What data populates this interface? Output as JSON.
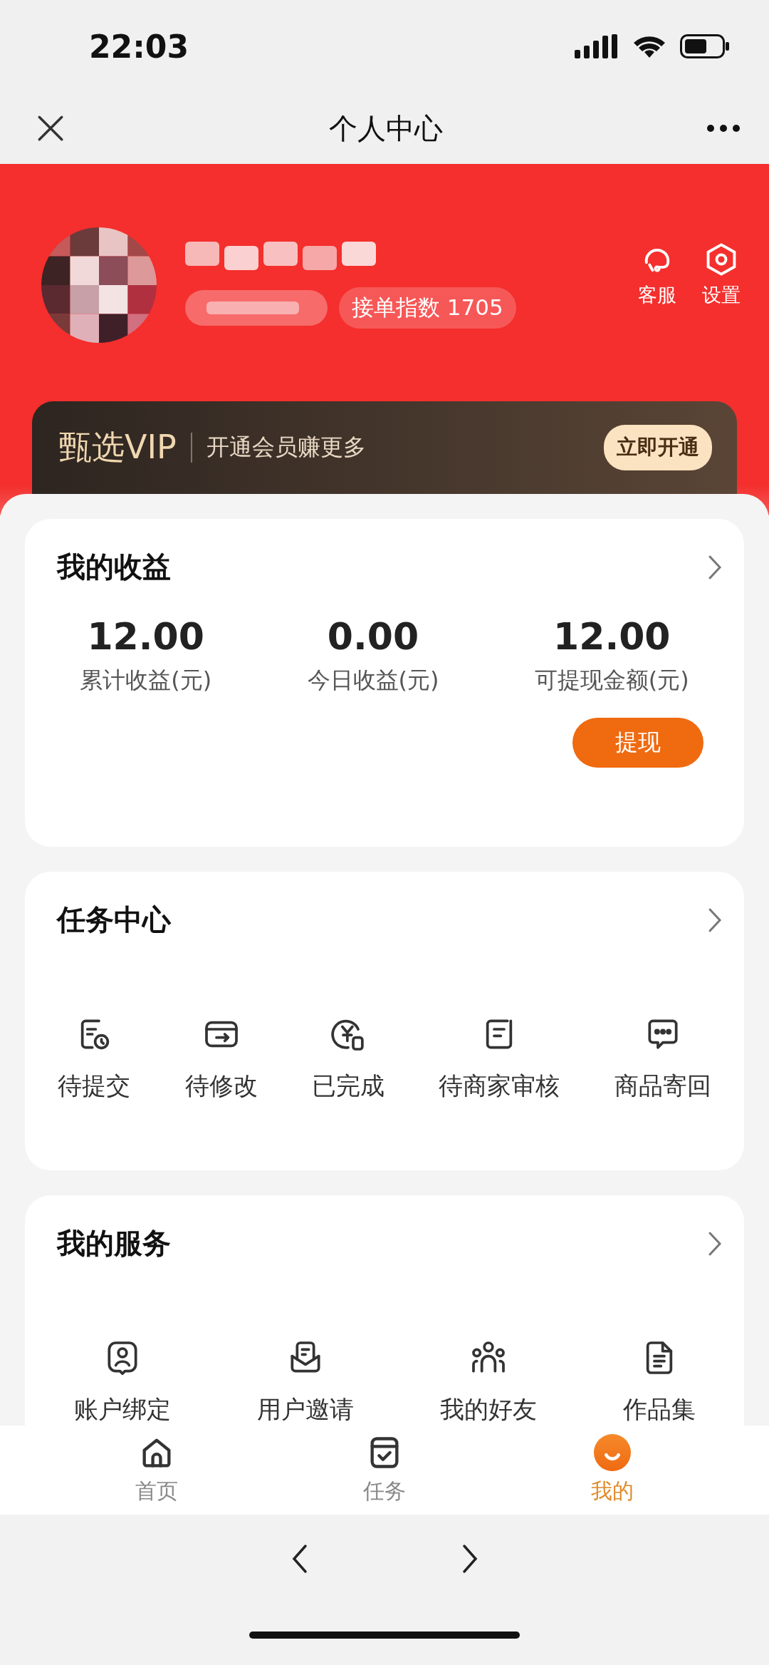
{
  "status_bar": {
    "time": "22:03"
  },
  "nav": {
    "title": "个人中心"
  },
  "profile": {
    "score_badge": "接单指数 1705",
    "actions": [
      {
        "label": "客服"
      },
      {
        "label": "设置"
      }
    ]
  },
  "vip": {
    "brand": "甄选VIP",
    "slogan": "开通会员赚更多",
    "button": "立即开通"
  },
  "income": {
    "title": "我的收益",
    "stats": [
      {
        "value": "12.00",
        "label": "累计收益(元)"
      },
      {
        "value": "0.00",
        "label": "今日收益(元)"
      },
      {
        "value": "12.00",
        "label": "可提现金额(元)"
      }
    ],
    "button": "提现"
  },
  "tasks": {
    "title": "任务中心",
    "items": [
      {
        "label": "待提交"
      },
      {
        "label": "待修改"
      },
      {
        "label": "已完成"
      },
      {
        "label": "待商家审核"
      },
      {
        "label": "商品寄回"
      }
    ]
  },
  "services": {
    "title": "我的服务",
    "items": [
      {
        "label": "账户绑定"
      },
      {
        "label": "用户邀请"
      },
      {
        "label": "我的好友"
      },
      {
        "label": "作品集"
      }
    ]
  },
  "tab_bar": {
    "items": [
      {
        "label": "首页",
        "selected": false
      },
      {
        "label": "任务",
        "selected": false
      },
      {
        "label": "我的",
        "selected": true
      }
    ]
  }
}
